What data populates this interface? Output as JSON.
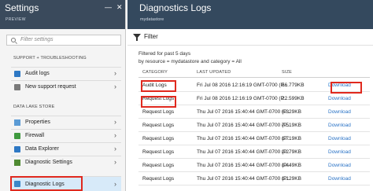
{
  "settings": {
    "title": "Settings",
    "subtitle": "PREVIEW",
    "pin_icon": "pin-icon",
    "close_icon": "close-icon",
    "filter_placeholder": "Filter settings",
    "sections": [
      {
        "label": "SUPPORT + TROUBLESHOOTING"
      },
      {
        "label": "DATA LAKE STORE"
      }
    ],
    "items": [
      {
        "label": "Audit logs",
        "icon": "audit-log-icon"
      },
      {
        "label": "New support request",
        "icon": "support-icon"
      },
      {
        "label": "Properties",
        "icon": "properties-icon"
      },
      {
        "label": "Firewall",
        "icon": "firewall-icon"
      },
      {
        "label": "Data Explorer",
        "icon": "data-explorer-icon"
      },
      {
        "label": "Diagnostic Settings",
        "icon": "diagnostic-settings-icon"
      },
      {
        "label": "Diagnostic Logs",
        "icon": "diagnostic-logs-icon",
        "selected": true
      }
    ]
  },
  "diagnostics": {
    "title": "Diagnostics Logs",
    "subtitle": "mydatastore",
    "filter_label": "Filter",
    "info_line1": "Filtered for past 5 days",
    "info_line2": "by resource = mydatastore and category = All",
    "columns": {
      "category": "CATEGORY",
      "last_updated": "LAST UPDATED",
      "size": "SIZE"
    },
    "rows": [
      {
        "category": "Audit Logs",
        "last_updated": "Fri Jul 08 2016 12:16:19 GMT-0700 (P...",
        "size": "56.779KB",
        "download": "Download"
      },
      {
        "category": "Request Logs",
        "last_updated": "Fri Jul 08 2016 12:16:19 GMT-0700 (P...",
        "size": "22.599KB",
        "download": "Download"
      },
      {
        "category": "Request Logs",
        "last_updated": "Thu Jul 07 2016 15:40:44 GMT-0700 (P...",
        "size": "6.329KB",
        "download": "Download"
      },
      {
        "category": "Request Logs",
        "last_updated": "Thu Jul 07 2016 15:40:44 GMT-0700 (P...",
        "size": "7.519KB",
        "download": "Download"
      },
      {
        "category": "Request Logs",
        "last_updated": "Thu Jul 07 2016 15:40:44 GMT-0700 (P...",
        "size": "1.719KB",
        "download": "Download"
      },
      {
        "category": "Request Logs",
        "last_updated": "Thu Jul 07 2016 15:40:44 GMT-0700 (P...",
        "size": "2.279KB",
        "download": "Download"
      },
      {
        "category": "Request Logs",
        "last_updated": "Thu Jul 07 2016 15:40:44 GMT-0700 (P...",
        "size": "1.449KB",
        "download": "Download"
      },
      {
        "category": "Request Logs",
        "last_updated": "Thu Jul 07 2016 15:40:44 GMT-0700 (P...",
        "size": "1.129KB",
        "download": "Download"
      }
    ]
  },
  "colors": {
    "header": "#34495e",
    "highlight": "#e0291e",
    "link": "#2a73c6",
    "selected": "#d7eaf9"
  }
}
